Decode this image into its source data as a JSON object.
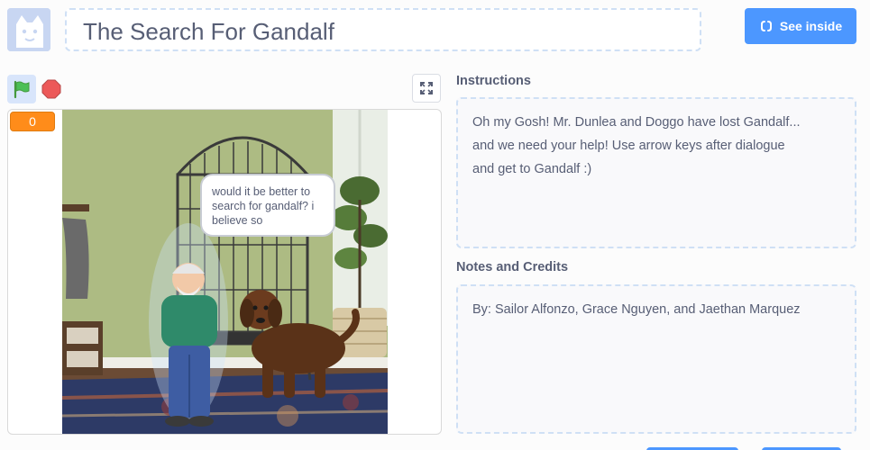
{
  "project": {
    "title": "The Search For Gandalf",
    "see_inside_label": "See inside"
  },
  "controls": {
    "flag_icon": "green-flag-icon",
    "stop_icon": "stop-icon",
    "fullscreen_icon": "fullscreen-icon"
  },
  "stage": {
    "score_value": "0",
    "speech_text": "would it be better to search for gandalf? i believe so"
  },
  "instructions": {
    "label": "Instructions",
    "lines": [
      "Oh my Gosh! Mr. Dunlea and Doggo have lost Gandalf...",
      "and we need your help! Use arrow keys after dialogue",
      "and get to Gandalf :)"
    ]
  },
  "notes": {
    "label": "Notes and Credits",
    "text": "By: Sailor Alfonzo, Grace Nguyen, and Jaethan Marquez"
  },
  "colors": {
    "accent": "#4c97ff",
    "monitor": "#ff8c1a",
    "text": "#575e75",
    "dashed_border": "#cfe0f5"
  }
}
